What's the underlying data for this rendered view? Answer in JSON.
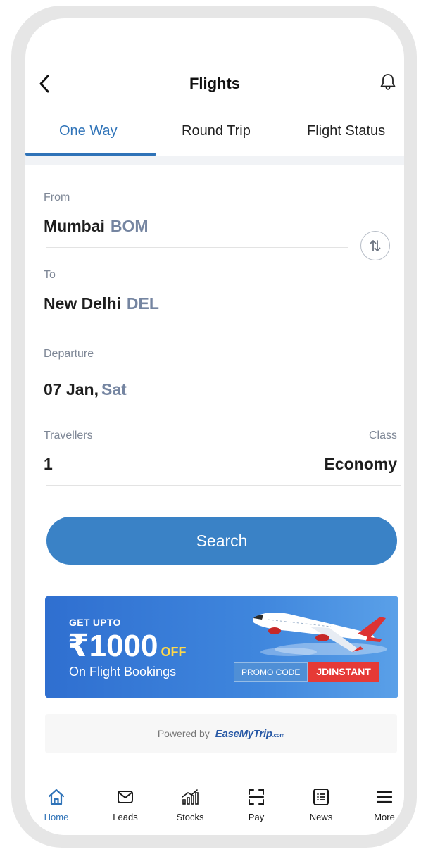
{
  "header": {
    "title": "Flights"
  },
  "tabs": [
    {
      "label": "One Way",
      "active": true
    },
    {
      "label": "Round Trip",
      "active": false
    },
    {
      "label": "Flight Status",
      "active": false
    }
  ],
  "form": {
    "from": {
      "label": "From",
      "city": "Mumbai",
      "code": "BOM"
    },
    "to": {
      "label": "To",
      "city": "New Delhi",
      "code": "DEL"
    },
    "departure": {
      "label": "Departure",
      "date": "07 Jan,",
      "day": "Sat"
    },
    "travellers": {
      "label": "Travellers",
      "value": "1"
    },
    "class": {
      "label": "Class",
      "value": "Economy"
    },
    "search_label": "Search"
  },
  "promo": {
    "get_upto": "GET UPTO",
    "amount": "₹1000",
    "off": "OFF",
    "subtitle": "On Flight Bookings",
    "code_label": "PROMO CODE",
    "code_value": "JDINSTANT"
  },
  "powered": {
    "text": "Powered by",
    "brand": "EaseMyTrip",
    "brand_suffix": ".com"
  },
  "bottom_nav": [
    {
      "label": "Home",
      "icon": "home-icon",
      "active": true
    },
    {
      "label": "Leads",
      "icon": "mail-icon",
      "active": false
    },
    {
      "label": "Stocks",
      "icon": "stocks-icon",
      "active": false
    },
    {
      "label": "Pay",
      "icon": "scan-icon",
      "active": false
    },
    {
      "label": "News",
      "icon": "news-icon",
      "active": false
    },
    {
      "label": "More",
      "icon": "menu-icon",
      "active": false
    }
  ],
  "colors": {
    "accent": "#2f73b8",
    "search_button": "#3a82c6",
    "promo_code_bg": "#e63a36"
  }
}
